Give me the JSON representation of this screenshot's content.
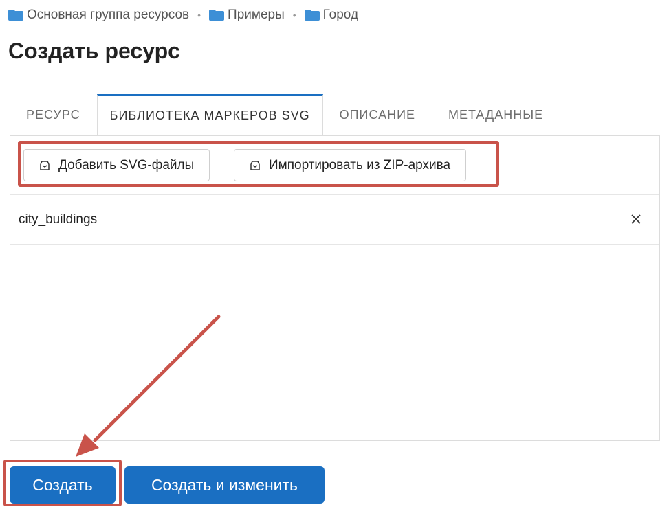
{
  "breadcrumb": [
    {
      "label": "Основная группа ресурсов"
    },
    {
      "label": "Примеры"
    },
    {
      "label": "Город"
    }
  ],
  "page_title": "Создать ресурс",
  "tabs": [
    {
      "label": "РЕСУРС",
      "active": false
    },
    {
      "label": "БИБЛИОТЕКА МАРКЕРОВ SVG",
      "active": true
    },
    {
      "label": "ОПИСАНИЕ",
      "active": false
    },
    {
      "label": "МЕТАДАННЫЕ",
      "active": false
    }
  ],
  "toolbar": {
    "add_svg_label": "Добавить SVG-файлы",
    "import_zip_label": "Импортировать из ZIP-архива"
  },
  "files": [
    {
      "name": "city_buildings"
    }
  ],
  "actions": {
    "create_label": "Создать",
    "create_and_edit_label": "Создать и изменить"
  },
  "colors": {
    "primary": "#1a6fc2",
    "annotation": "#c9534a",
    "folder": "#3d8fd6"
  }
}
